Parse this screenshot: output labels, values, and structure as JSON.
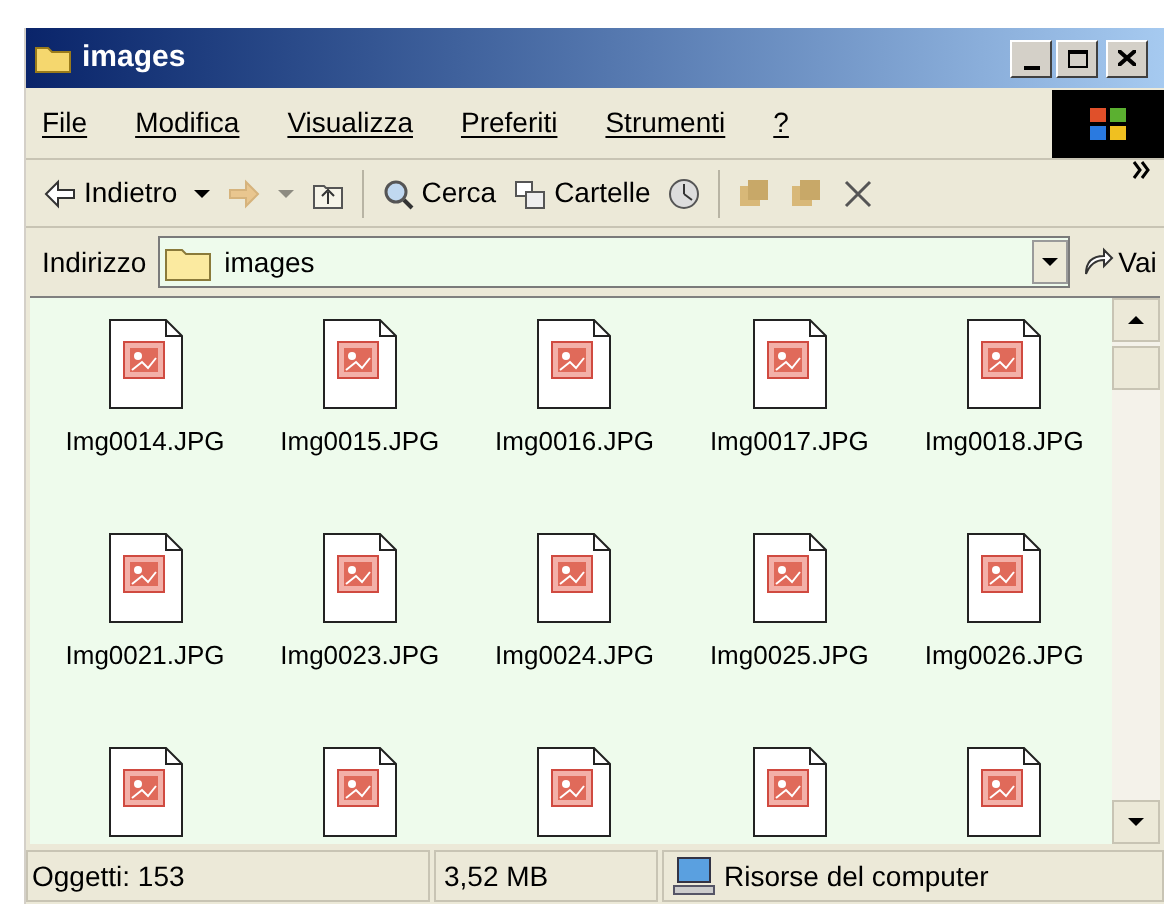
{
  "window": {
    "title": "images"
  },
  "menu": [
    "File",
    "Modifica",
    "Visualizza",
    "Preferiti",
    "Strumenti",
    "?"
  ],
  "toolbar": [
    {
      "kind": "back",
      "label": "Indietro",
      "disabled": false
    },
    {
      "kind": "forward",
      "disabled": true
    },
    {
      "kind": "up"
    },
    {
      "kind": "sep"
    },
    {
      "kind": "search",
      "label": "Cerca"
    },
    {
      "kind": "folders",
      "label": "Cartelle"
    },
    {
      "kind": "history"
    },
    {
      "kind": "sep"
    },
    {
      "kind": "move"
    },
    {
      "kind": "copy"
    },
    {
      "kind": "delete"
    }
  ],
  "address": {
    "label": "Indirizzo",
    "value": "images",
    "go": "Vai"
  },
  "files": [
    {
      "kind": "labeled",
      "name": "Img0014.JPG"
    },
    {
      "kind": "labeled",
      "name": "Img0015.JPG"
    },
    {
      "kind": "labeled",
      "name": "Img0016.JPG"
    },
    {
      "kind": "labeled",
      "name": "Img0017.JPG"
    },
    {
      "kind": "labeled",
      "name": "Img0018.JPG"
    },
    {
      "kind": "labeled",
      "name": "Img0021.JPG"
    },
    {
      "kind": "labeled",
      "name": "Img0023.JPG"
    },
    {
      "kind": "labeled",
      "name": "Img0024.JPG"
    },
    {
      "kind": "labeled",
      "name": "Img0025.JPG"
    },
    {
      "kind": "labeled",
      "name": "Img0026.JPG"
    },
    {
      "kind": "cut"
    },
    {
      "kind": "cut"
    },
    {
      "kind": "cut"
    },
    {
      "kind": "cut"
    },
    {
      "kind": "cut"
    }
  ],
  "status_bar": {
    "objects": "Oggetti: 153",
    "size": "3,52 MB",
    "zone": "Risorse del computer"
  }
}
